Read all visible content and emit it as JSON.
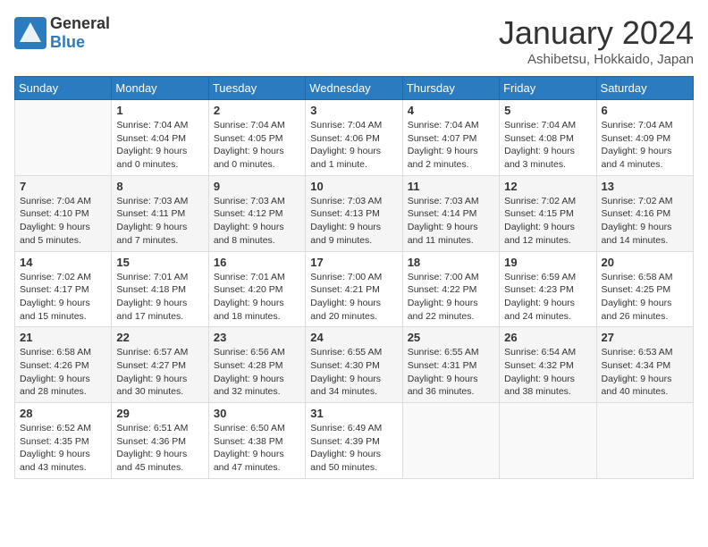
{
  "logo": {
    "general": "General",
    "blue": "Blue"
  },
  "title": "January 2024",
  "subtitle": "Ashibetsu, Hokkaido, Japan",
  "days_header": [
    "Sunday",
    "Monday",
    "Tuesday",
    "Wednesday",
    "Thursday",
    "Friday",
    "Saturday"
  ],
  "weeks": [
    [
      {
        "day": "",
        "empty": true
      },
      {
        "day": "1",
        "sunrise": "Sunrise: 7:04 AM",
        "sunset": "Sunset: 4:04 PM",
        "daylight": "Daylight: 9 hours and 0 minutes."
      },
      {
        "day": "2",
        "sunrise": "Sunrise: 7:04 AM",
        "sunset": "Sunset: 4:05 PM",
        "daylight": "Daylight: 9 hours and 0 minutes."
      },
      {
        "day": "3",
        "sunrise": "Sunrise: 7:04 AM",
        "sunset": "Sunset: 4:06 PM",
        "daylight": "Daylight: 9 hours and 1 minute."
      },
      {
        "day": "4",
        "sunrise": "Sunrise: 7:04 AM",
        "sunset": "Sunset: 4:07 PM",
        "daylight": "Daylight: 9 hours and 2 minutes."
      },
      {
        "day": "5",
        "sunrise": "Sunrise: 7:04 AM",
        "sunset": "Sunset: 4:08 PM",
        "daylight": "Daylight: 9 hours and 3 minutes."
      },
      {
        "day": "6",
        "sunrise": "Sunrise: 7:04 AM",
        "sunset": "Sunset: 4:09 PM",
        "daylight": "Daylight: 9 hours and 4 minutes."
      }
    ],
    [
      {
        "day": "7",
        "sunrise": "Sunrise: 7:04 AM",
        "sunset": "Sunset: 4:10 PM",
        "daylight": "Daylight: 9 hours and 5 minutes."
      },
      {
        "day": "8",
        "sunrise": "Sunrise: 7:03 AM",
        "sunset": "Sunset: 4:11 PM",
        "daylight": "Daylight: 9 hours and 7 minutes."
      },
      {
        "day": "9",
        "sunrise": "Sunrise: 7:03 AM",
        "sunset": "Sunset: 4:12 PM",
        "daylight": "Daylight: 9 hours and 8 minutes."
      },
      {
        "day": "10",
        "sunrise": "Sunrise: 7:03 AM",
        "sunset": "Sunset: 4:13 PM",
        "daylight": "Daylight: 9 hours and 9 minutes."
      },
      {
        "day": "11",
        "sunrise": "Sunrise: 7:03 AM",
        "sunset": "Sunset: 4:14 PM",
        "daylight": "Daylight: 9 hours and 11 minutes."
      },
      {
        "day": "12",
        "sunrise": "Sunrise: 7:02 AM",
        "sunset": "Sunset: 4:15 PM",
        "daylight": "Daylight: 9 hours and 12 minutes."
      },
      {
        "day": "13",
        "sunrise": "Sunrise: 7:02 AM",
        "sunset": "Sunset: 4:16 PM",
        "daylight": "Daylight: 9 hours and 14 minutes."
      }
    ],
    [
      {
        "day": "14",
        "sunrise": "Sunrise: 7:02 AM",
        "sunset": "Sunset: 4:17 PM",
        "daylight": "Daylight: 9 hours and 15 minutes."
      },
      {
        "day": "15",
        "sunrise": "Sunrise: 7:01 AM",
        "sunset": "Sunset: 4:18 PM",
        "daylight": "Daylight: 9 hours and 17 minutes."
      },
      {
        "day": "16",
        "sunrise": "Sunrise: 7:01 AM",
        "sunset": "Sunset: 4:20 PM",
        "daylight": "Daylight: 9 hours and 18 minutes."
      },
      {
        "day": "17",
        "sunrise": "Sunrise: 7:00 AM",
        "sunset": "Sunset: 4:21 PM",
        "daylight": "Daylight: 9 hours and 20 minutes."
      },
      {
        "day": "18",
        "sunrise": "Sunrise: 7:00 AM",
        "sunset": "Sunset: 4:22 PM",
        "daylight": "Daylight: 9 hours and 22 minutes."
      },
      {
        "day": "19",
        "sunrise": "Sunrise: 6:59 AM",
        "sunset": "Sunset: 4:23 PM",
        "daylight": "Daylight: 9 hours and 24 minutes."
      },
      {
        "day": "20",
        "sunrise": "Sunrise: 6:58 AM",
        "sunset": "Sunset: 4:25 PM",
        "daylight": "Daylight: 9 hours and 26 minutes."
      }
    ],
    [
      {
        "day": "21",
        "sunrise": "Sunrise: 6:58 AM",
        "sunset": "Sunset: 4:26 PM",
        "daylight": "Daylight: 9 hours and 28 minutes."
      },
      {
        "day": "22",
        "sunrise": "Sunrise: 6:57 AM",
        "sunset": "Sunset: 4:27 PM",
        "daylight": "Daylight: 9 hours and 30 minutes."
      },
      {
        "day": "23",
        "sunrise": "Sunrise: 6:56 AM",
        "sunset": "Sunset: 4:28 PM",
        "daylight": "Daylight: 9 hours and 32 minutes."
      },
      {
        "day": "24",
        "sunrise": "Sunrise: 6:55 AM",
        "sunset": "Sunset: 4:30 PM",
        "daylight": "Daylight: 9 hours and 34 minutes."
      },
      {
        "day": "25",
        "sunrise": "Sunrise: 6:55 AM",
        "sunset": "Sunset: 4:31 PM",
        "daylight": "Daylight: 9 hours and 36 minutes."
      },
      {
        "day": "26",
        "sunrise": "Sunrise: 6:54 AM",
        "sunset": "Sunset: 4:32 PM",
        "daylight": "Daylight: 9 hours and 38 minutes."
      },
      {
        "day": "27",
        "sunrise": "Sunrise: 6:53 AM",
        "sunset": "Sunset: 4:34 PM",
        "daylight": "Daylight: 9 hours and 40 minutes."
      }
    ],
    [
      {
        "day": "28",
        "sunrise": "Sunrise: 6:52 AM",
        "sunset": "Sunset: 4:35 PM",
        "daylight": "Daylight: 9 hours and 43 minutes."
      },
      {
        "day": "29",
        "sunrise": "Sunrise: 6:51 AM",
        "sunset": "Sunset: 4:36 PM",
        "daylight": "Daylight: 9 hours and 45 minutes."
      },
      {
        "day": "30",
        "sunrise": "Sunrise: 6:50 AM",
        "sunset": "Sunset: 4:38 PM",
        "daylight": "Daylight: 9 hours and 47 minutes."
      },
      {
        "day": "31",
        "sunrise": "Sunrise: 6:49 AM",
        "sunset": "Sunset: 4:39 PM",
        "daylight": "Daylight: 9 hours and 50 minutes."
      },
      {
        "day": "",
        "empty": true
      },
      {
        "day": "",
        "empty": true
      },
      {
        "day": "",
        "empty": true
      }
    ]
  ]
}
